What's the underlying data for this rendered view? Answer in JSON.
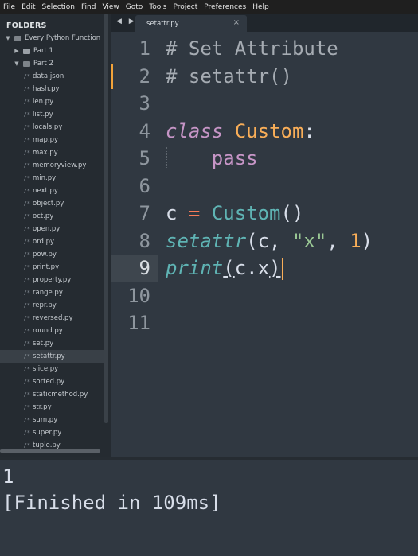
{
  "menu": [
    "File",
    "Edit",
    "Selection",
    "Find",
    "View",
    "Goto",
    "Tools",
    "Project",
    "Preferences",
    "Help"
  ],
  "sidebar": {
    "title": "FOLDERS",
    "root": "Every Python Function",
    "part1": "Part 1",
    "part2": "Part 2",
    "files": [
      "data.json",
      "hash.py",
      "len.py",
      "list.py",
      "locals.py",
      "map.py",
      "max.py",
      "memoryview.py",
      "min.py",
      "next.py",
      "object.py",
      "oct.py",
      "open.py",
      "ord.py",
      "pow.py",
      "print.py",
      "property.py",
      "range.py",
      "repr.py",
      "reversed.py",
      "round.py",
      "set.py",
      "setattr.py",
      "slice.py",
      "sorted.py",
      "staticmethod.py",
      "str.py",
      "sum.py",
      "super.py",
      "tuple.py"
    ],
    "selected_file": "setattr.py",
    "file_icon": "/*"
  },
  "tabbar": {
    "nav": "◀ ▶",
    "tab_label": "setattr.py",
    "close": "×"
  },
  "editor": {
    "line_numbers": [
      "1",
      "2",
      "3",
      "4",
      "5",
      "6",
      "7",
      "8",
      "9",
      "10",
      "11"
    ],
    "active_line": 9,
    "lines": [
      [
        {
          "t": "# Set Attribute",
          "c": "c-comment"
        }
      ],
      [
        {
          "t": "# setattr()",
          "c": "c-comment"
        }
      ],
      [],
      [
        {
          "t": "class",
          "c": "c-kw"
        },
        {
          "t": " ",
          "c": "c-plain"
        },
        {
          "t": "Custom",
          "c": "c-cls"
        },
        {
          "t": ":",
          "c": "c-plain"
        }
      ],
      [
        {
          "t": "    ",
          "c": "c-plain"
        },
        {
          "t": "pass",
          "c": "c-kw2"
        }
      ],
      [],
      [
        {
          "t": "c ",
          "c": "c-plain"
        },
        {
          "t": "=",
          "c": "c-op"
        },
        {
          "t": " ",
          "c": "c-plain"
        },
        {
          "t": "Custom",
          "c": "c-fn"
        },
        {
          "t": "()",
          "c": "c-plain"
        }
      ],
      [
        {
          "t": "setattr",
          "c": "c-fni"
        },
        {
          "t": "(c, ",
          "c": "c-plain"
        },
        {
          "t": "\"x\"",
          "c": "c-str"
        },
        {
          "t": ", ",
          "c": "c-plain"
        },
        {
          "t": "1",
          "c": "c-num"
        },
        {
          "t": ")",
          "c": "c-plain"
        }
      ],
      [
        {
          "t": "print",
          "c": "c-fni"
        },
        {
          "t": "(",
          "c": "c-plain u"
        },
        {
          "t": "c.x",
          "c": "c-plain"
        },
        {
          "t": ")",
          "c": "c-plain u"
        }
      ],
      [],
      []
    ]
  },
  "console": {
    "output": [
      "1",
      "[Finished in 109ms]"
    ]
  }
}
